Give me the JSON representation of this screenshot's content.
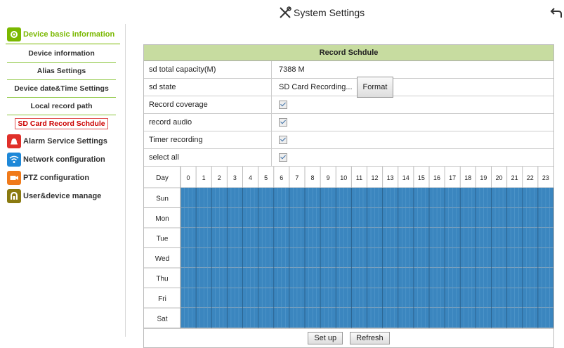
{
  "header": {
    "title": "System Settings"
  },
  "sidebar": {
    "categories": [
      {
        "label": "Device basic information",
        "icon": "gear-icon",
        "color": "#7ab800"
      },
      {
        "label": "Alarm Service Settings",
        "icon": "alarm-bell-icon",
        "color": "#e0302a"
      },
      {
        "label": "Network configuration",
        "icon": "wifi-icon",
        "color": "#1e88d8"
      },
      {
        "label": "PTZ configuration",
        "icon": "ptz-camera-icon",
        "color": "#f07a1a"
      },
      {
        "label": "User&device manage",
        "icon": "user-icon",
        "color": "#8a7a10"
      }
    ],
    "sub_items": [
      {
        "label": "Device information"
      },
      {
        "label": "Alias Settings"
      },
      {
        "label": "Device date&Time Settings"
      },
      {
        "label": "Local record path"
      },
      {
        "label": "SD Card Record Schdule"
      }
    ]
  },
  "panel": {
    "title": "Record Schdule",
    "rows": [
      {
        "label": "sd total capacity(M)",
        "value": "7388 M"
      },
      {
        "label": "sd state",
        "value": "SD Card Recording...",
        "button": "Format"
      },
      {
        "label": "Record coverage",
        "checked": true
      },
      {
        "label": "record audio",
        "checked": true
      },
      {
        "label": "Timer recording",
        "checked": true
      },
      {
        "label": "select all",
        "checked": true
      }
    ],
    "schedule": {
      "day_header": "Day",
      "hours": [
        "0",
        "1",
        "2",
        "3",
        "4",
        "5",
        "6",
        "7",
        "8",
        "9",
        "10",
        "11",
        "12",
        "13",
        "14",
        "15",
        "16",
        "17",
        "18",
        "19",
        "20",
        "21",
        "22",
        "23"
      ],
      "days": [
        "Sun",
        "Mon",
        "Tue",
        "Wed",
        "Thu",
        "Fri",
        "Sat"
      ],
      "fill_color": "#3b86bf",
      "all_selected": true
    },
    "buttons": {
      "setup": "Set up",
      "refresh": "Refresh"
    }
  }
}
